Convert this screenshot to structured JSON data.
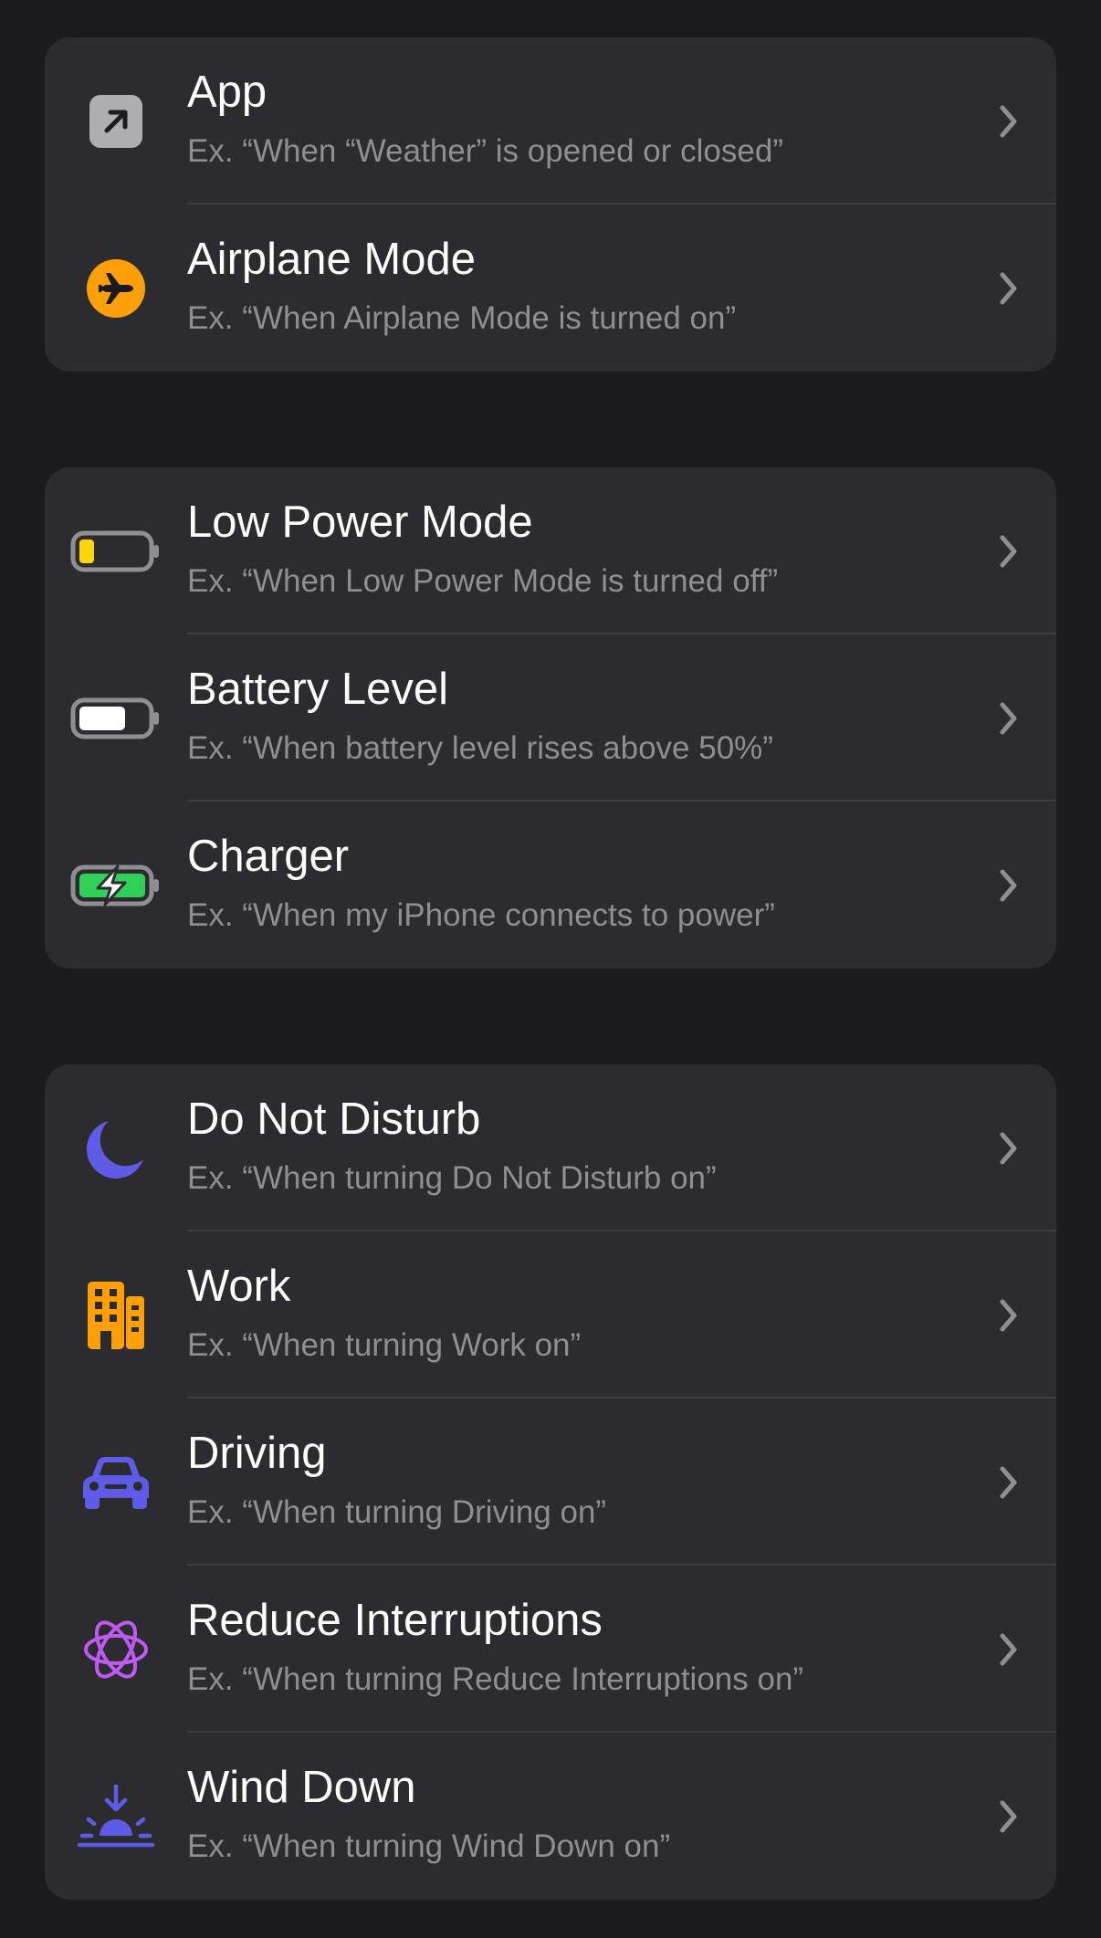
{
  "groups": [
    {
      "rows": [
        {
          "title": "App",
          "subtitle": "Ex. “When “Weather” is opened or closed”",
          "icon": "app-icon"
        },
        {
          "title": "Airplane Mode",
          "subtitle": "Ex. “When Airplane Mode is turned on”",
          "icon": "airplane-icon"
        }
      ]
    },
    {
      "rows": [
        {
          "title": "Low Power Mode",
          "subtitle": "Ex. “When Low Power Mode is turned off”",
          "icon": "low-battery-icon"
        },
        {
          "title": "Battery Level",
          "subtitle": "Ex. “When battery level rises above 50%”",
          "icon": "battery-icon"
        },
        {
          "title": "Charger",
          "subtitle": "Ex. “When my iPhone connects to power”",
          "icon": "charging-battery-icon"
        }
      ]
    },
    {
      "rows": [
        {
          "title": "Do Not Disturb",
          "subtitle": "Ex. “When turning Do Not Disturb on”",
          "icon": "moon-icon"
        },
        {
          "title": "Work",
          "subtitle": "Ex. “When turning Work on”",
          "icon": "building-icon"
        },
        {
          "title": "Driving",
          "subtitle": "Ex. “When turning Driving on”",
          "icon": "car-icon"
        },
        {
          "title": "Reduce Interruptions",
          "subtitle": "Ex. “When turning Reduce Interruptions on”",
          "icon": "interruptions-icon"
        },
        {
          "title": "Wind Down",
          "subtitle": "Ex. “When turning Wind Down on”",
          "icon": "sunset-icon"
        }
      ]
    }
  ],
  "colors": {
    "background": "#1c1c1e",
    "card": "#2c2c2e",
    "title": "#ffffff",
    "subtitle": "#8e8e93",
    "airplane": "#ff9f0a",
    "low_power": "#ffd60a",
    "charging": "#30d158",
    "focus": "#5e5ce6",
    "work": "#ff9f0a",
    "reduce_interruptions": "#bf5af2"
  }
}
